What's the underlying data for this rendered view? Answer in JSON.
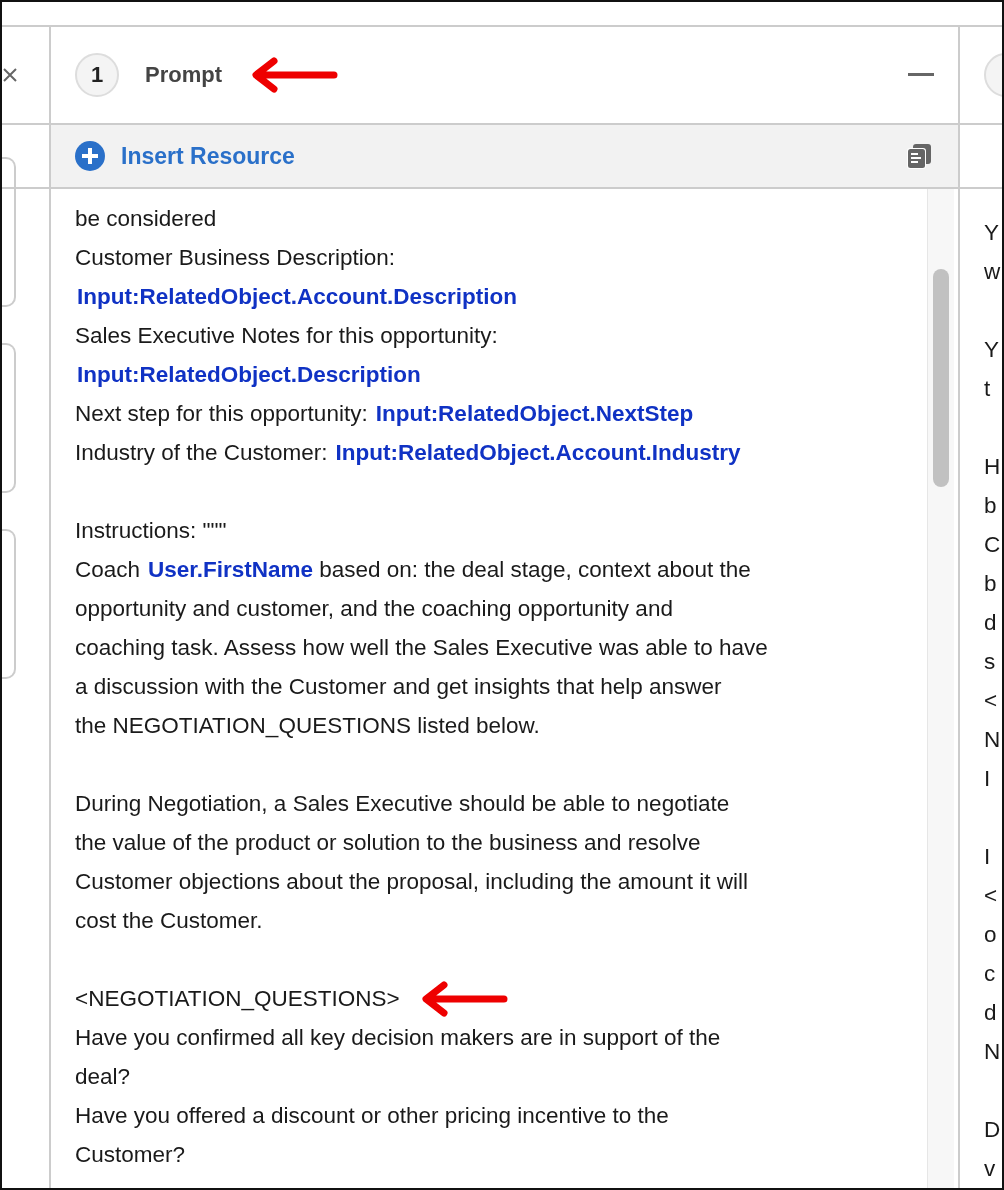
{
  "header": {
    "step_number": "1",
    "title": "Prompt",
    "annotation_arrow": true
  },
  "toolbar": {
    "insert_label": "Insert Resource"
  },
  "prompt_lines": [
    {
      "kind": "text",
      "segments": [
        {
          "kind": "text",
          "text": "be considered"
        }
      ]
    },
    {
      "kind": "text",
      "segments": [
        {
          "kind": "text",
          "text": "Customer Business Description:"
        }
      ]
    },
    {
      "kind": "text",
      "segments": [
        {
          "kind": "variable",
          "text": "Input:RelatedObject.Account.Description"
        }
      ]
    },
    {
      "kind": "text",
      "segments": [
        {
          "kind": "text",
          "text": "Sales Executive Notes for this opportunity:"
        }
      ]
    },
    {
      "kind": "text",
      "segments": [
        {
          "kind": "variable",
          "text": "Input:RelatedObject.Description"
        }
      ]
    },
    {
      "kind": "text",
      "segments": [
        {
          "kind": "text",
          "text": "Next step for this opportunity:"
        },
        {
          "kind": "variable",
          "text": "Input:RelatedObject.NextStep"
        }
      ]
    },
    {
      "kind": "text",
      "segments": [
        {
          "kind": "text",
          "text": "Industry of the Customer:"
        },
        {
          "kind": "variable",
          "text": "Input:RelatedObject.Account.Industry"
        }
      ]
    },
    {
      "kind": "blank"
    },
    {
      "kind": "text",
      "segments": [
        {
          "kind": "text",
          "text": "Instructions: \"\"\""
        }
      ]
    },
    {
      "kind": "text",
      "segments": [
        {
          "kind": "text",
          "text": "Coach"
        },
        {
          "kind": "variable",
          "text": "User.FirstName"
        },
        {
          "kind": "text",
          "text": "based on: the deal stage, context about the"
        }
      ]
    },
    {
      "kind": "text",
      "segments": [
        {
          "kind": "text",
          "text": "opportunity and customer, and the coaching opportunity and"
        }
      ]
    },
    {
      "kind": "text",
      "segments": [
        {
          "kind": "text",
          "text": "coaching task. Assess how well the Sales Executive was able to have"
        }
      ]
    },
    {
      "kind": "text",
      "segments": [
        {
          "kind": "text",
          "text": "a discussion with the Customer and get insights that help answer"
        }
      ]
    },
    {
      "kind": "text",
      "segments": [
        {
          "kind": "text",
          "text": "the NEGOTIATION_QUESTIONS listed below."
        }
      ]
    },
    {
      "kind": "blank"
    },
    {
      "kind": "text",
      "segments": [
        {
          "kind": "text",
          "text": "During Negotiation, a Sales Executive should be able to negotiate"
        }
      ]
    },
    {
      "kind": "text",
      "segments": [
        {
          "kind": "text",
          "text": "the value of the product or solution to the business and resolve"
        }
      ]
    },
    {
      "kind": "text",
      "segments": [
        {
          "kind": "text",
          "text": "Customer objections about the proposal, including the amount it will"
        }
      ]
    },
    {
      "kind": "text",
      "segments": [
        {
          "kind": "text",
          "text": "cost the Customer."
        }
      ]
    },
    {
      "kind": "blank"
    },
    {
      "kind": "text",
      "annotation_arrow": true,
      "segments": [
        {
          "kind": "text",
          "text": "<NEGOTIATION_QUESTIONS>"
        }
      ]
    },
    {
      "kind": "text",
      "segments": [
        {
          "kind": "text",
          "text": "Have you confirmed all key decision makers are in support of the"
        }
      ]
    },
    {
      "kind": "text",
      "segments": [
        {
          "kind": "text",
          "text": "deal?"
        }
      ]
    },
    {
      "kind": "text",
      "segments": [
        {
          "kind": "text",
          "text": "Have you offered a discount or other pricing incentive to the"
        }
      ]
    },
    {
      "kind": "text",
      "segments": [
        {
          "kind": "text",
          "text": "Customer?"
        }
      ]
    }
  ],
  "right_panel": {
    "paragraphs": [
      [
        "Y",
        "w"
      ],
      [
        "Y",
        "t"
      ],
      [
        "H",
        "b",
        "C",
        "b",
        "d",
        "s",
        "<",
        "N",
        "I"
      ],
      [
        "I",
        "<",
        "o",
        "c",
        "d",
        "N"
      ],
      [
        "D",
        "v"
      ]
    ]
  }
}
